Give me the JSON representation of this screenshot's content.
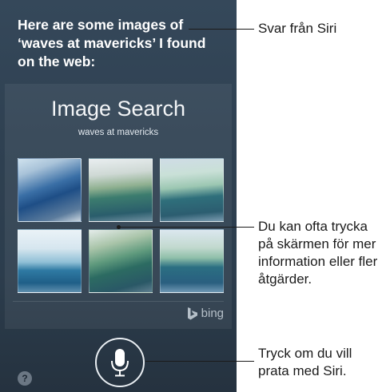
{
  "siri": {
    "response_text": "Here are some images of ‘waves at mavericks’ I found on the web:"
  },
  "image_search": {
    "title": "Image Search",
    "query": "waves at mavericks",
    "provider": "bing",
    "thumbnails": [
      {
        "icon": "wave-photo"
      },
      {
        "icon": "wave-photo"
      },
      {
        "icon": "wave-photo"
      },
      {
        "icon": "wave-photo"
      },
      {
        "icon": "wave-photo"
      },
      {
        "icon": "wave-photo"
      }
    ]
  },
  "controls": {
    "mic_icon": "microphone-icon",
    "help_label": "?"
  },
  "callouts": {
    "siri_answer": "Svar från Siri",
    "tap_screen": "Du kan ofta trycka på skärmen för mer information eller fler åtgärder.",
    "tap_to_talk": "Tryck om du vill prata med Siri."
  },
  "colors": {
    "panel": "#2f4152",
    "text_light": "#ffffff",
    "callout_text": "#1b1b1b"
  }
}
